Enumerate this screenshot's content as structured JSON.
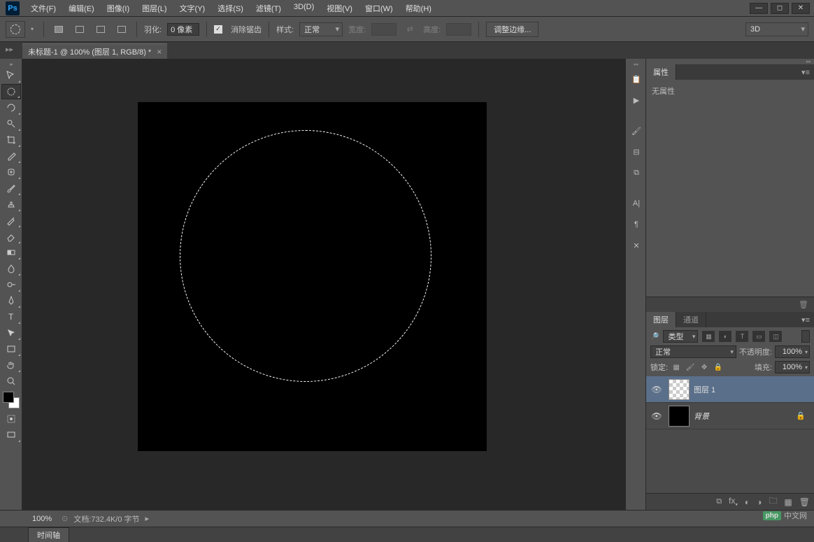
{
  "app": {
    "name": "Ps"
  },
  "menu": {
    "file": "文件(F)",
    "edit": "编辑(E)",
    "image": "图像(I)",
    "layer": "图层(L)",
    "type": "文字(Y)",
    "select": "选择(S)",
    "filter": "滤镜(T)",
    "threeD": "3D(D)",
    "view": "视图(V)",
    "window": "窗口(W)",
    "help": "帮助(H)"
  },
  "options": {
    "feather_label": "羽化:",
    "feather_value": "0 像素",
    "antialias_label": "消除锯齿",
    "style_label": "样式:",
    "style_value": "正常",
    "width_label": "宽度:",
    "width_value": "",
    "height_label": "高度:",
    "height_value": "",
    "refine_edge": "调整边缘...",
    "workspace": "3D"
  },
  "document": {
    "tab_title": "未标题-1 @ 100% (图层 1, RGB/8) *"
  },
  "tools": {
    "move": "move-tool",
    "marquee": "marquee-tool",
    "lasso": "lasso-tool",
    "quickselect": "quick-select-tool",
    "crop": "crop-tool",
    "eyedropper": "eyedropper-tool",
    "healing": "healing-brush-tool",
    "brush": "brush-tool",
    "stamp": "clone-stamp-tool",
    "history": "history-brush-tool",
    "eraser": "eraser-tool",
    "gradient": "gradient-tool",
    "blur": "blur-tool",
    "dodge": "dodge-tool",
    "pen": "pen-tool",
    "type": "type-tool",
    "path": "path-select-tool",
    "shape": "shape-tool",
    "hand": "hand-tool",
    "zoom": "zoom-tool"
  },
  "properties": {
    "tab": "属性",
    "content": "无属性"
  },
  "layers": {
    "tab_layers": "图层",
    "tab_channels": "通道",
    "filter_kind": "类型",
    "blend_mode": "正常",
    "opacity_label": "不透明度:",
    "opacity_value": "100%",
    "lock_label": "锁定:",
    "fill_label": "填充:",
    "fill_value": "100%",
    "items": [
      {
        "name": "图层 1",
        "visible": true,
        "locked": false,
        "thumb": "checker"
      },
      {
        "name": "背景",
        "visible": true,
        "locked": true,
        "thumb": "black",
        "italic": true
      }
    ]
  },
  "status": {
    "zoom": "100%",
    "doc_info": "文档:732.4K/0 字节"
  },
  "timeline": {
    "tab": "时间轴"
  },
  "watermark": {
    "logo": "php",
    "text": "中文网"
  }
}
